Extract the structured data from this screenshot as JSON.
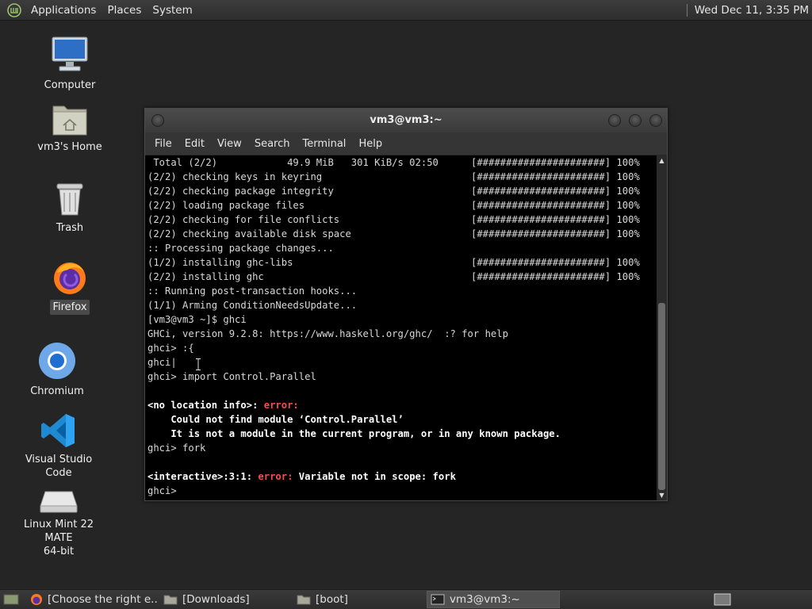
{
  "top_panel": {
    "menus": [
      "Applications",
      "Places",
      "System"
    ],
    "clock": "Wed Dec 11,  3:35 PM"
  },
  "desktop": {
    "icons": [
      {
        "label": "Computer"
      },
      {
        "label": "vm3's Home"
      },
      {
        "label": "Trash"
      },
      {
        "label": "Firefox"
      },
      {
        "label": "Chromium"
      },
      {
        "label": "Visual Studio Code"
      },
      {
        "label": "Linux Mint 22 MATE",
        "label2": "64-bit"
      }
    ]
  },
  "window": {
    "title": "vm3@vm3:~",
    "menu": [
      "File",
      "Edit",
      "View",
      "Search",
      "Terminal",
      "Help"
    ]
  },
  "terminal": {
    "lines": [
      {
        "text": " Total (2/2)            49.9 MiB   301 KiB/s 02:50",
        "bar": "[######################] 100%"
      },
      {
        "text": "(2/2) checking keys in keyring",
        "bar": "[######################] 100%"
      },
      {
        "text": "(2/2) checking package integrity",
        "bar": "[######################] 100%"
      },
      {
        "text": "(2/2) loading package files",
        "bar": "[######################] 100%"
      },
      {
        "text": "(2/2) checking for file conflicts",
        "bar": "[######################] 100%"
      },
      {
        "text": "(2/2) checking available disk space",
        "bar": "[######################] 100%"
      },
      {
        "text": ":: Processing package changes..."
      },
      {
        "text": "(1/2) installing ghc-libs",
        "bar": "[######################] 100%"
      },
      {
        "text": "(2/2) installing ghc",
        "bar": "[######################] 100%"
      },
      {
        "text": ":: Running post-transaction hooks..."
      },
      {
        "text": "(1/1) Arming ConditionNeedsUpdate..."
      },
      {
        "text": "[vm3@vm3 ~]$ ghci"
      },
      {
        "text": "GHCi, version 9.2.8: https://www.haskell.org/ghc/  :? for help"
      },
      {
        "text": "ghci> :{"
      },
      {
        "text": "ghci|"
      },
      {
        "text": "ghci> import Control.Parallel"
      },
      {
        "text": ""
      },
      {
        "text": "<no location info>: ",
        "err": "error:",
        "bold": true
      },
      {
        "text": "    Could not find module ‘Control.Parallel’",
        "bold": true
      },
      {
        "text": "    It is not a module in the current program, or in any known package.",
        "bold": true
      },
      {
        "text": "ghci> fork"
      },
      {
        "text": ""
      },
      {
        "text": "<interactive>:3:1: ",
        "err": "error:",
        "after": " Variable not in scope: fork",
        "bold": true
      },
      {
        "text": "ghci> "
      }
    ]
  },
  "taskbar": {
    "tasks": [
      {
        "label": "[Choose the right e..."
      },
      {
        "label": "[Downloads]"
      },
      {
        "label": "[boot]"
      },
      {
        "label": "vm3@vm3:~"
      }
    ]
  }
}
